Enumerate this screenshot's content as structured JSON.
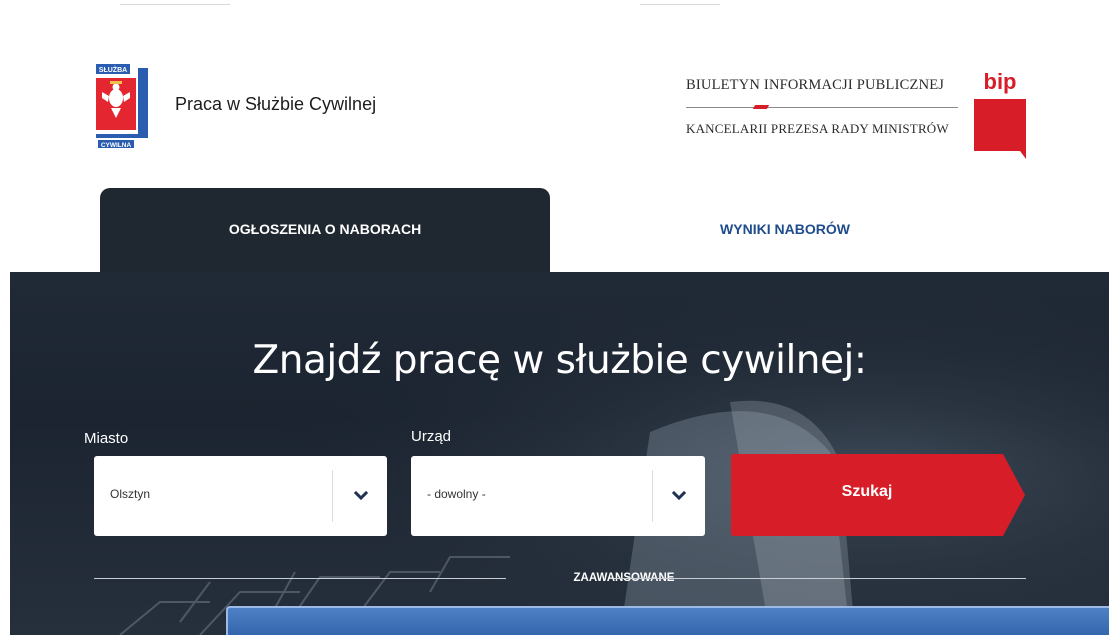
{
  "header": {
    "site_title": "Praca w Służbie Cywilnej",
    "emblem_top_text": "SŁUŻBA",
    "emblem_bottom_text": "CYWILNA",
    "bip_line1": "BIULETYN INFORMACJI PUBLICZNEJ",
    "bip_line2": "KANCELARII PREZESA RADY MINISTRÓW",
    "bip_logo_text": "bip"
  },
  "tabs": [
    {
      "label": "OGŁOSZENIA O NABORACH",
      "active": true
    },
    {
      "label": "WYNIKI NABORÓW",
      "active": false
    }
  ],
  "hero": {
    "title": "Znajdź pracę w służbie cywilnej:",
    "city_label": "Miasto",
    "city_value": "Olsztyn",
    "office_label": "Urząd",
    "office_value": "- dowolny -",
    "search_label": "Szukaj",
    "advanced_label": "ZAAWANSOWANE"
  },
  "colors": {
    "hero_bg": "#1f2731",
    "accent_red": "#d71e28",
    "tab_link_blue": "#1e4c8c",
    "chevron_navy": "#1e3252",
    "dialog_blue": "#3e70b8"
  },
  "icons": [
    "poland-eagle-emblem-icon",
    "bip-logo-icon",
    "chevron-down-icon"
  ]
}
